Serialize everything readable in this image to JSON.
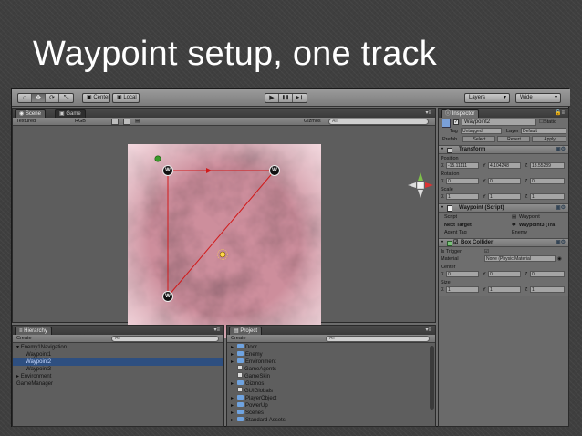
{
  "slide": {
    "title": "Waypoint setup, one track"
  },
  "toolbar": {
    "tools": [
      "○",
      "✥",
      "⟳",
      "⤡"
    ],
    "center_label": "Center",
    "local_label": "Local",
    "play": "▶",
    "pause": "❚❚",
    "step": "▶❙",
    "layers_label": "Layers",
    "layout_label": "Wide"
  },
  "scene_pane": {
    "tabs": [
      "Scene",
      "Game"
    ],
    "render_mode": "Textured",
    "color_mode": "RGB",
    "gizmos_label": "Gizmos",
    "search_prefix": "All",
    "waypoint_marker": "W"
  },
  "hierarchy_pane": {
    "tab": "Hierarchy",
    "create_label": "Create",
    "search_prefix": "All",
    "items": [
      {
        "label": "Enemy1Navigation",
        "indent": 0,
        "expanded": true,
        "selected": false
      },
      {
        "label": "Waypoint1",
        "indent": 1,
        "selected": false
      },
      {
        "label": "Waypoint2",
        "indent": 1,
        "selected": true
      },
      {
        "label": "Waypoint3",
        "indent": 1,
        "selected": false
      },
      {
        "label": "Environment",
        "indent": 0,
        "expanded": false,
        "selected": false
      },
      {
        "label": "GameManager",
        "indent": 0,
        "selected": false
      }
    ]
  },
  "project_pane": {
    "tab": "Project",
    "create_label": "Create",
    "search_prefix": "All",
    "items": [
      {
        "label": "Door",
        "type": "folder"
      },
      {
        "label": "Enemy",
        "type": "folder"
      },
      {
        "label": "Environment",
        "type": "folder"
      },
      {
        "label": "GameAgents",
        "type": "file"
      },
      {
        "label": "GameSkin",
        "type": "file"
      },
      {
        "label": "Gizmos",
        "type": "folder"
      },
      {
        "label": "GUIGlobals",
        "type": "file"
      },
      {
        "label": "PlayerObject",
        "type": "folder"
      },
      {
        "label": "PowerUp",
        "type": "folder"
      },
      {
        "label": "Scenes",
        "type": "folder"
      },
      {
        "label": "Standard Assets",
        "type": "folder"
      }
    ]
  },
  "inspector": {
    "tab": "Inspector",
    "object_name": "Waypoint2",
    "static_label": "Static",
    "tag_label": "Tag",
    "tag_value": "Untagged",
    "layer_label": "Layer",
    "layer_value": "Default",
    "prefab_label": "Prefab",
    "prefab_buttons": [
      "Select",
      "Revert",
      "Apply"
    ],
    "transform": {
      "title": "Transform",
      "position_label": "Position",
      "position": {
        "x": "-15.11111",
        "y": "4.104248",
        "z": "13.55289"
      },
      "rotation_label": "Rotation",
      "rotation": {
        "x": "0",
        "y": "0",
        "z": "0"
      },
      "scale_label": "Scale",
      "scale": {
        "x": "1",
        "y": "1",
        "z": "1"
      }
    },
    "waypoint_script": {
      "title": "Waypoint (Script)",
      "script_label": "Script",
      "script_value": "Waypoint",
      "next_target_label": "Next Target",
      "next_target_value": "Waypoint3 (Tra",
      "agent_tag_label": "Agent Tag",
      "agent_tag_value": "Enemy"
    },
    "box_collider": {
      "title": "Box Collider",
      "is_trigger_label": "Is Trigger",
      "material_label": "Material",
      "material_value": "None (Physic Material",
      "center_label": "Center",
      "center": {
        "x": "0",
        "y": "0",
        "z": "0"
      },
      "size_label": "Size",
      "size": {
        "x": "1",
        "y": "1",
        "z": "1"
      }
    }
  },
  "colors": {
    "selection": "#2e4f80",
    "path_line": "#d21a1a",
    "terrain_base": "#c98a98"
  }
}
